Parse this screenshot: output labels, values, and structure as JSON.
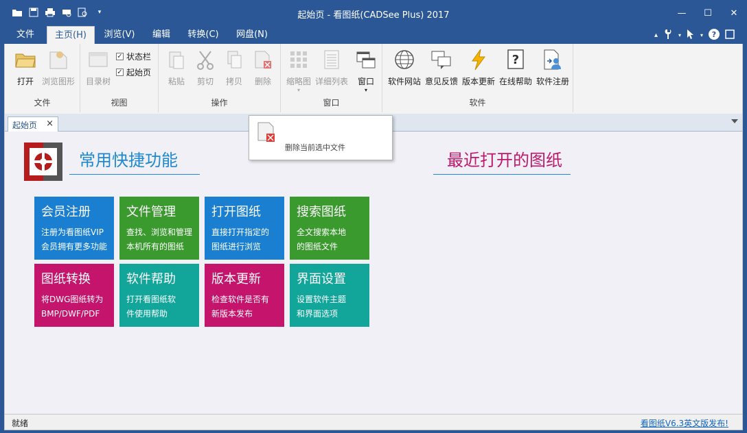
{
  "window": {
    "title": "起始页 - 看图纸(CADSee Plus) 2017"
  },
  "qat_icons": [
    "open-icon",
    "save-icon",
    "print-icon",
    "print-preview-icon",
    "zoom-icon",
    "customize-icon"
  ],
  "menu": {
    "tabs": [
      {
        "label": "文件"
      },
      {
        "label": "主页(H)"
      },
      {
        "label": "浏览(V)"
      },
      {
        "label": "编辑"
      },
      {
        "label": "转换(C)"
      },
      {
        "label": "网盘(N)"
      }
    ]
  },
  "ribbon": {
    "file_group": {
      "label": "文件",
      "open": "打开",
      "browse": "浏览图形"
    },
    "view_group": {
      "label": "视图",
      "tree": "目录树",
      "statusbar": "状态栏",
      "startpage": "起始页"
    },
    "ops_group": {
      "label": "操作",
      "paste": "粘贴",
      "cut": "剪切",
      "copy": "拷贝",
      "delete": "删除"
    },
    "window_group": {
      "label": "窗口",
      "thumbs": "缩略图",
      "details": "详细列表",
      "window": "窗口"
    },
    "software_group": {
      "label": "软件",
      "website": "软件网站",
      "feedback": "意见反馈",
      "update": "版本更新",
      "help": "在线帮助",
      "register": "软件注册"
    }
  },
  "doc_tab": {
    "label": "起始页",
    "close": "×"
  },
  "tooltip": {
    "text": "删除当前选中文件"
  },
  "start_page": {
    "left_heading": "常用快捷功能",
    "right_heading": "最近打开的图纸",
    "tiles": [
      {
        "title": "会员注册",
        "line1": "注册为看图纸VIP",
        "line2": "会员拥有更多功能",
        "color": "#1a7fd1"
      },
      {
        "title": "文件管理",
        "line1": "查找、浏览和管理",
        "line2": "本机所有的图纸",
        "color": "#3a9a2e"
      },
      {
        "title": "打开图纸",
        "line1": "直接打开指定的",
        "line2": "图纸进行浏览",
        "color": "#1a7fd1"
      },
      {
        "title": "搜索图纸",
        "line1": "全文搜索本地",
        "line2": "的图纸文件",
        "color": "#3a9a2e"
      },
      {
        "title": "图纸转换",
        "line1": "将DWG图纸转为",
        "line2": "BMP/DWF/PDF",
        "color": "#c4146c"
      },
      {
        "title": "软件帮助",
        "line1": "打开看图纸软",
        "line2": "件使用帮助",
        "color": "#12a69b"
      },
      {
        "title": "版本更新",
        "line1": "检查软件是否有",
        "line2": "新版本发布",
        "color": "#c4146c"
      },
      {
        "title": "界面设置",
        "line1": "设置软件主题",
        "line2": "和界面选项",
        "color": "#12a69b"
      }
    ]
  },
  "status": {
    "text": "就绪",
    "news": "看图纸V6.3英文版发布!"
  }
}
